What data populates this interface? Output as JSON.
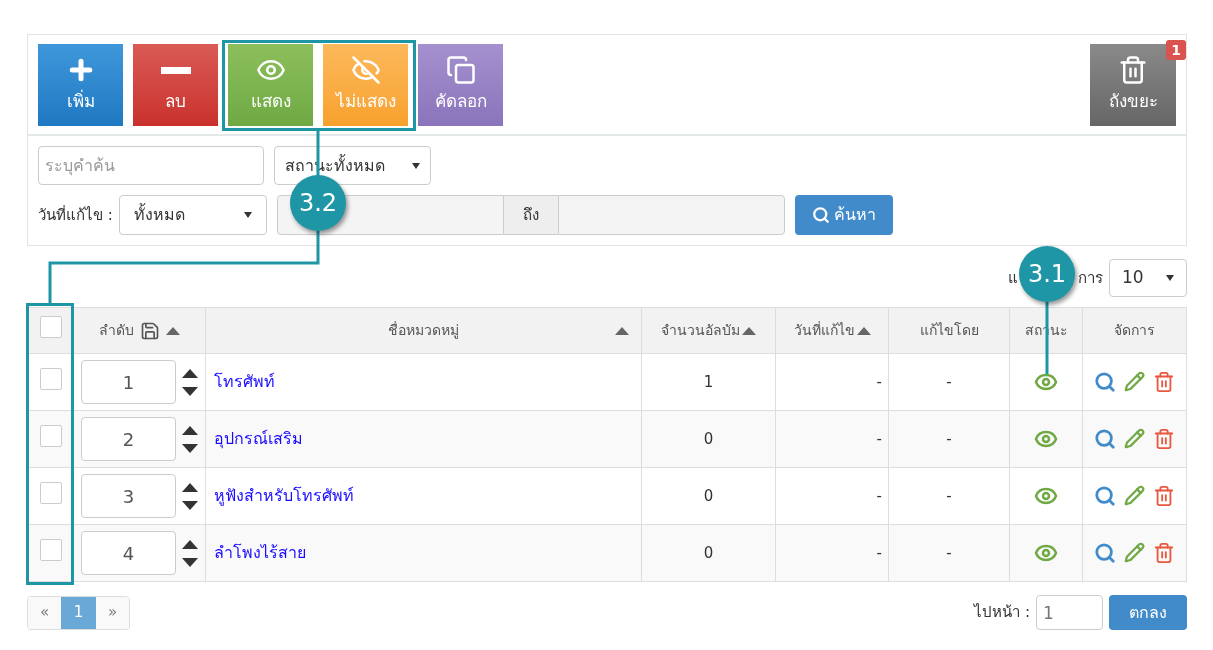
{
  "toolbar": {
    "buttons": [
      {
        "kind": "add",
        "label": "เพิ่ม"
      },
      {
        "kind": "delete",
        "label": "ลบ"
      },
      {
        "kind": "show",
        "label": "แสดง"
      },
      {
        "kind": "hide",
        "label": "ไม่แสดง"
      },
      {
        "kind": "copy",
        "label": "คัดลอก"
      }
    ],
    "trash": {
      "label": "ถังขยะ",
      "badge": "1"
    }
  },
  "filters": {
    "search": {
      "placeholder": "ระบุคำค้น"
    },
    "status_select": "สถานะทั้งหมด",
    "date_label": "วันที่แก้ไข :",
    "date_select": "ทั้งหมด",
    "date_to": "ถึง",
    "search_button": "ค้นหา"
  },
  "per_page": {
    "label_start": "แ",
    "label_end": "การ",
    "value": "10"
  },
  "table": {
    "select_all_checked": false,
    "columns": [
      {
        "kind": "order",
        "label": "ลำดับ",
        "sortable": true
      },
      {
        "kind": "name",
        "label": "ชื่อหมวดหมู่",
        "sortable": true
      },
      {
        "kind": "count",
        "label": "จำนวนอัลบัม",
        "sortable": true
      },
      {
        "kind": "date",
        "label": "วันที่แก้ไข",
        "sortable": true
      },
      {
        "kind": "by",
        "label": "แก้ไขโดย",
        "sortable": false
      },
      {
        "kind": "status",
        "label": "สถานะ",
        "sortable": false
      },
      {
        "kind": "actions",
        "label": "จัดการ",
        "sortable": false
      }
    ],
    "rows": [
      {
        "checked": false,
        "order": "1",
        "name": "โทรศัพท์",
        "albums": "1",
        "modified": "-",
        "modified_by": "-",
        "visible": true
      },
      {
        "checked": false,
        "order": "2",
        "name": "อุปกรณ์เสริม",
        "albums": "0",
        "modified": "-",
        "modified_by": "-",
        "visible": true
      },
      {
        "checked": false,
        "order": "3",
        "name": "หูฟังสำหรับโทรศัพท์",
        "albums": "0",
        "modified": "-",
        "modified_by": "-",
        "visible": true
      },
      {
        "checked": false,
        "order": "4",
        "name": "ลำโพงไร้สาย",
        "albums": "0",
        "modified": "-",
        "modified_by": "-",
        "visible": true
      }
    ]
  },
  "pagination": {
    "prev": "«",
    "pages": [
      {
        "label": "1",
        "selected": true
      }
    ],
    "next": "»",
    "goto_label": "ไปหน้า :",
    "goto_value": "1",
    "go_button": "ตกลง"
  },
  "callouts": [
    {
      "label": "3.1"
    },
    {
      "label": "3.2"
    }
  ]
}
